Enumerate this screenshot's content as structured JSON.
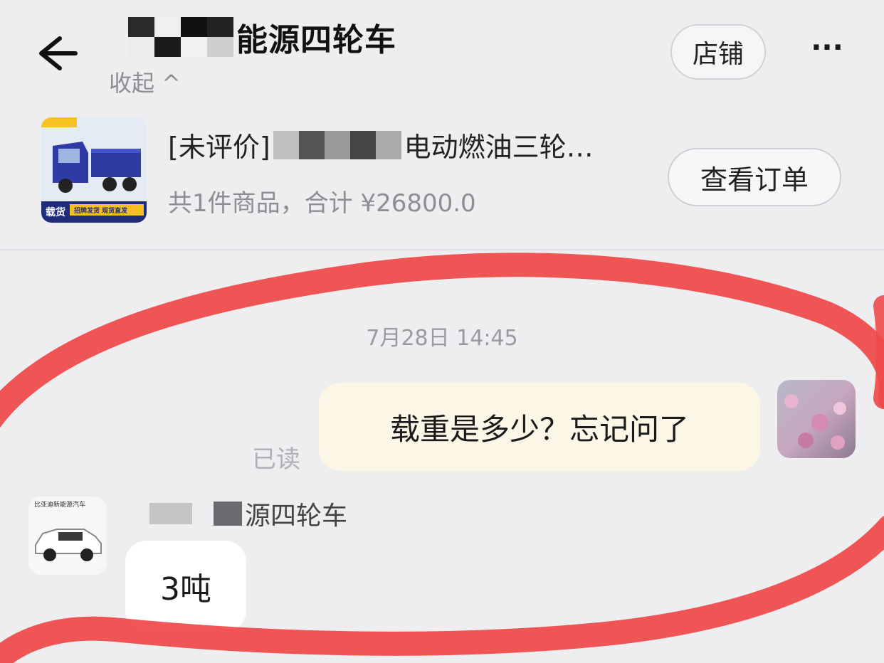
{
  "header": {
    "title": "能源四轮车",
    "collapse_label": "收起 ^",
    "store_button": "店铺",
    "more_button": "···"
  },
  "order": {
    "title_prefix": "[未评价]",
    "title_suffix": "电动燃油三轮…",
    "summary": "共1件商品，合计 ¥26800.0",
    "view_order_button": "查看订单",
    "thumb_badge": "载货",
    "thumb_strip": "招牌发货 现货直发"
  },
  "chat": {
    "timestamp": "7月28日 14:45",
    "my_message": "载重是多少？忘记问了",
    "read_status": "已读",
    "shop_name": "源四轮车",
    "shop_avatar_caption": "比亚迪新能源汽车",
    "reply_message": "3吨"
  },
  "colors": {
    "background": "#eeeef0",
    "my_bubble": "#fbf6e6",
    "their_bubble": "#ffffff",
    "annotation": "#f04848",
    "muted_text": "#8e8e93"
  },
  "icons": {
    "back": "arrow-left-icon",
    "more": "ellipsis-icon"
  }
}
